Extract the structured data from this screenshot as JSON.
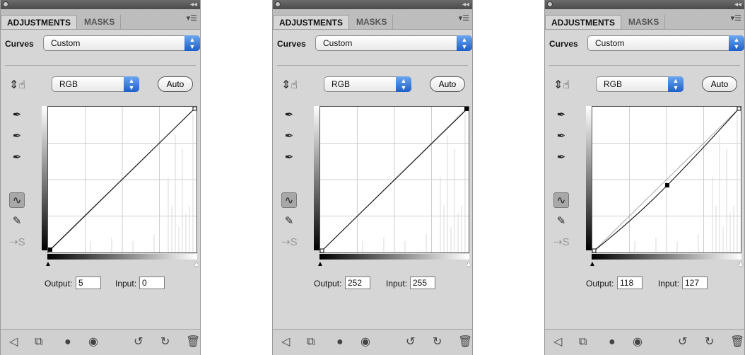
{
  "panels": [
    {
      "tabs": {
        "adjustments": "ADJUSTMENTS",
        "masks": "MASKS"
      },
      "curves_label": "Curves",
      "preset": "Custom",
      "channel": "RGB",
      "auto_label": "Auto",
      "output_label": "Output:",
      "output_value": "5",
      "input_label": "Input:",
      "input_value": "0"
    },
    {
      "tabs": {
        "adjustments": "ADJUSTMENTS",
        "masks": "MASKS"
      },
      "curves_label": "Curves",
      "preset": "Custom",
      "channel": "RGB",
      "auto_label": "Auto",
      "output_label": "Output:",
      "output_value": "252",
      "input_label": "Input:",
      "input_value": "255"
    },
    {
      "tabs": {
        "adjustments": "ADJUSTMENTS",
        "masks": "MASKS"
      },
      "curves_label": "Curves",
      "preset": "Custom",
      "channel": "RGB",
      "auto_label": "Auto",
      "output_label": "Output:",
      "output_value": "118",
      "input_label": "Input:",
      "input_value": "127"
    }
  ],
  "icons": [
    "hand-target-icon",
    "eyedropper-black-icon",
    "eyedropper-gray-icon",
    "eyedropper-white-icon",
    "curve-tool-icon",
    "pencil-icon",
    "smooth-icon",
    "back-icon",
    "clip-icon",
    "visibility-mask-icon",
    "eye-icon",
    "view-previous-icon",
    "reset-icon",
    "trash-icon"
  ]
}
